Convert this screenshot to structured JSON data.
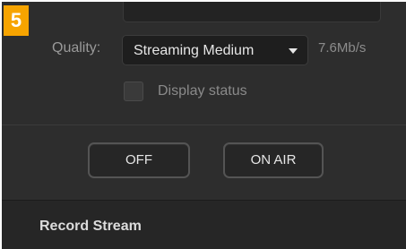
{
  "step": {
    "number": "5"
  },
  "quality": {
    "label": "Quality:",
    "selected": "Streaming Medium",
    "dropdown_icon": "chevron-down-icon",
    "bitrate": "7.6Mb/s"
  },
  "display_status": {
    "label": "Display status",
    "checked": false
  },
  "buttons": {
    "off_label": "OFF",
    "on_air_label": "ON AIR"
  },
  "record_stream": {
    "title": "Record Stream"
  },
  "colors": {
    "badge": "#f7a400",
    "panel": "#2d2d2d",
    "section": "#262626"
  }
}
